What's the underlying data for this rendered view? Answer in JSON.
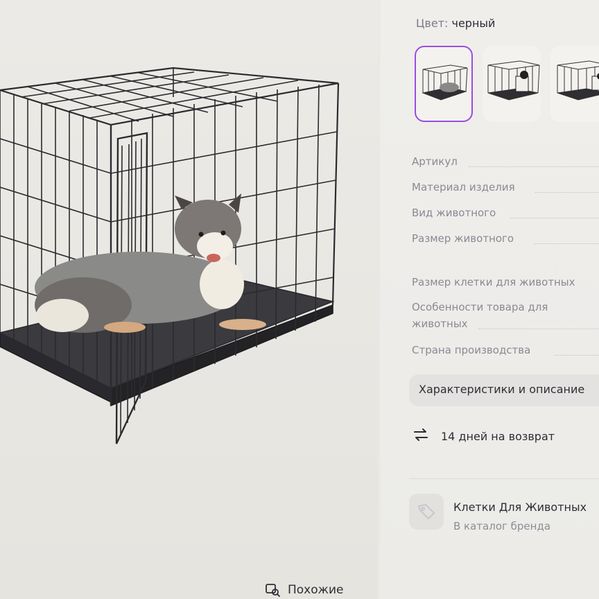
{
  "color": {
    "label": "Цвет:",
    "value": "черный"
  },
  "thumbnails": [
    {
      "name": "cage-photo-1",
      "selected": true
    },
    {
      "name": "cage-photo-2",
      "selected": false
    },
    {
      "name": "cage-photo-3",
      "selected": false
    }
  ],
  "specs": [
    "Артикул",
    "Материал изделия",
    "Вид животного",
    "Размер животного",
    "Размер клетки для животных",
    "Особенности товара для",
    "животных",
    "Страна производства"
  ],
  "characteristics_button": "Характеристики и описание",
  "return_policy": "14 дней на возврат",
  "brand": {
    "name": "Клетки Для Животных",
    "catalog_link": "В каталог бренда"
  },
  "similar_button": "Похожие",
  "colors": {
    "accent": "#9b4de0",
    "text": "#2d2d35",
    "muted": "#8a8993"
  }
}
